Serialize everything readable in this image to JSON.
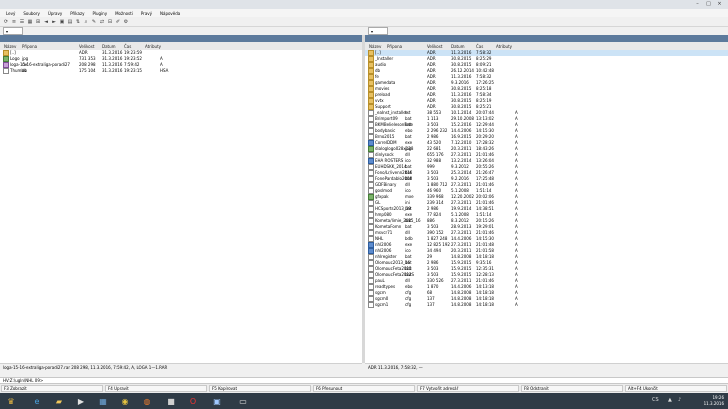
{
  "menu": [
    "Levý",
    "Soubory",
    "Úpravy",
    "Příkazy",
    "Pluginy",
    "Možnosti",
    "Pravý",
    "Nápověda"
  ],
  "left_panel": {
    "columns": {
      "name": "Název",
      "ext": "Přípona",
      "size": "Velikost",
      "date": "Datum",
      "time": "Čas",
      "attr": "Atributy"
    },
    "rows": [
      {
        "icon": "folder",
        "name": "[..]",
        "ext": "",
        "size": "ADR",
        "date": "31.3.2016",
        "time": "19:23:59",
        "attr": ""
      },
      {
        "icon": "img",
        "name": "Logo",
        "ext": "jpg",
        "size": "731 353",
        "date": "31.3.2016",
        "time": "19:23:52",
        "attr": "A"
      },
      {
        "icon": "arc",
        "name": "loga-15-16-extraliga-poradi27",
        "ext": "rar",
        "size": "208 298",
        "date": "11.3.2016",
        "time": "7:59:42",
        "attr": "A"
      },
      {
        "icon": "file",
        "name": "Thumbs",
        "ext": "db",
        "size": "175 104",
        "date": "31.3.2016",
        "time": "19:23:15",
        "attr": "HSA"
      }
    ]
  },
  "right_panel": {
    "columns": {
      "name": "Název",
      "ext": "Přípona",
      "size": "Velikost",
      "date": "Datum",
      "time": "Čas",
      "attr": "Atributy"
    },
    "rows": [
      {
        "icon": "folder",
        "name": "[..]",
        "ext": "",
        "size": "ADR",
        "date": "11.3.2016",
        "time": "7:58:32",
        "attr": ""
      },
      {
        "icon": "folder",
        "name": "_Installer",
        "ext": "",
        "size": "ADR",
        "date": "30.8.2015",
        "time": "8:25:29",
        "attr": ""
      },
      {
        "icon": "folder",
        "name": "audio",
        "ext": "",
        "size": "ADR",
        "date": "30.8.2015",
        "time": "8:09:21",
        "attr": ""
      },
      {
        "icon": "folder",
        "name": "db",
        "ext": "",
        "size": "ADR",
        "date": "26.12.2014",
        "time": "10:42:48",
        "attr": ""
      },
      {
        "icon": "folder",
        "name": "fe",
        "ext": "",
        "size": "ADR",
        "date": "11.3.2016",
        "time": "7:58:32",
        "attr": ""
      },
      {
        "icon": "folder",
        "name": "gamedata",
        "ext": "",
        "size": "ADR",
        "date": "9.3.2016",
        "time": "17:26:25",
        "attr": ""
      },
      {
        "icon": "folder",
        "name": "movies",
        "ext": "",
        "size": "ADR",
        "date": "30.8.2015",
        "time": "8:25:18",
        "attr": ""
      },
      {
        "icon": "folder",
        "name": "preload",
        "ext": "",
        "size": "ADR",
        "date": "11.3.2016",
        "time": "7:58:34",
        "attr": ""
      },
      {
        "icon": "folder",
        "name": "vvtx",
        "ext": "",
        "size": "ADR",
        "date": "30.8.2015",
        "time": "8:25:19",
        "attr": ""
      },
      {
        "icon": "folder",
        "name": "Support",
        "ext": "",
        "size": "ADR",
        "date": "30.8.2015",
        "time": "8:25:21",
        "attr": ""
      },
      {
        "icon": "file",
        "name": "_eaInst_installer",
        "ext": "txt",
        "size": "38 553",
        "date": "10.1.2014",
        "time": "20:07:44",
        "attr": "A"
      },
      {
        "icon": "file",
        "name": "Brimport09",
        "ext": "bat",
        "size": "1 113",
        "date": "29.10.2008",
        "time": "13:13:02",
        "attr": "A"
      },
      {
        "icon": "file",
        "name": "BKMBelielesonFete",
        "ext": "bat",
        "size": "3 503",
        "date": "15.2.2016",
        "time": "12:29:44",
        "attr": "A"
      },
      {
        "icon": "file",
        "name": "bodybasic",
        "ext": "ebo",
        "size": "2 296 232",
        "date": "14.4.2006",
        "time": "14:15:30",
        "attr": "A"
      },
      {
        "icon": "file",
        "name": "Brno2015",
        "ext": "bat",
        "size": "2 986",
        "date": "16.9.2015",
        "time": "20:29:20",
        "attr": "A"
      },
      {
        "icon": "exe",
        "name": "CorrelDDM",
        "ext": "exe",
        "size": "43 520",
        "date": "7.12.2010",
        "time": "17:28:32",
        "attr": "A"
      },
      {
        "icon": "img",
        "name": "dialoglogo028x128",
        "ext": "jpg",
        "size": "22 681",
        "date": "20.3.2011",
        "time": "18:43:26",
        "attr": "A"
      },
      {
        "icon": "file",
        "name": "dinlysock",
        "ext": "dll",
        "size": "655 176",
        "date": "27.3.2011",
        "time": "21:01:46",
        "attr": "A"
      },
      {
        "icon": "exe",
        "name": "EHA ROSTERS",
        "ext": "ico",
        "size": "32 988",
        "date": "13.2.2014",
        "time": "13:26:04",
        "attr": "A"
      },
      {
        "icon": "file",
        "name": "EUHDSKK_2014",
        "ext": "bat",
        "size": "999",
        "date": "9.3.2012",
        "time": "20:55:26",
        "attr": "A"
      },
      {
        "icon": "file",
        "name": "Fono/Lr/ivenn2016",
        "ext": "bat",
        "size": "3 503",
        "date": "25.3.2014",
        "time": "21:26:47",
        "attr": "A"
      },
      {
        "icon": "file",
        "name": "FonePardablo2008",
        "ext": "bat",
        "size": "3 503",
        "date": "9.2.2016",
        "time": "17:25:48",
        "attr": "A"
      },
      {
        "icon": "file",
        "name": "GDFBinary",
        "ext": "dll",
        "size": "1 880 712",
        "date": "27.3.2011",
        "time": "21:01:46",
        "attr": "A"
      },
      {
        "icon": "file",
        "name": "goslmod",
        "ext": "ico",
        "size": "46 960",
        "date": "5.1.2008",
        "time": "1:51:14",
        "attr": "A"
      },
      {
        "icon": "img",
        "name": "gfxpak",
        "ext": "mxe",
        "size": "339 968",
        "date": "12.20.2002",
        "time": "20:02:06",
        "attr": "A"
      },
      {
        "icon": "file",
        "name": "GL",
        "ext": "ini",
        "size": "239 314",
        "date": "27.3.2011",
        "time": "21:01:46",
        "attr": "A"
      },
      {
        "icon": "file",
        "name": "HCSports2013_39",
        "ext": "bat",
        "size": "2 986",
        "date": "19.9.2014",
        "time": "14:38:51",
        "attr": "A"
      },
      {
        "icon": "file",
        "name": "hmp080",
        "ext": "exe",
        "size": "77 824",
        "date": "5.1.2008",
        "time": "1:51:14",
        "attr": "A"
      },
      {
        "icon": "file",
        "name": "Kometa/limie_2015_16",
        "ext": "bat",
        "size": "886",
        "date": "8.3.2012",
        "time": "20:15:26",
        "attr": "A"
      },
      {
        "icon": "file",
        "name": "KometaFomn",
        "ext": "bat",
        "size": "3 503",
        "date": "28.9.2013",
        "time": "19:29:01",
        "attr": "A"
      },
      {
        "icon": "file",
        "name": "msvcr71",
        "ext": "dll",
        "size": "390 152",
        "date": "27.3.2011",
        "time": "21:01:46",
        "attr": "A"
      },
      {
        "icon": "file",
        "name": "NHL",
        "ext": "bdb",
        "size": "1 827 248",
        "date": "14.4.2006",
        "time": "14:15:30",
        "attr": "A"
      },
      {
        "icon": "exe",
        "name": "nhl2006",
        "ext": "exe",
        "size": "12 825 192",
        "date": "27.3.2011",
        "time": "21:01:48",
        "attr": "A"
      },
      {
        "icon": "exe",
        "name": "nhl2006",
        "ext": "ico",
        "size": "34 494",
        "date": "20.3.2011",
        "time": "21:01:58",
        "attr": "A"
      },
      {
        "icon": "file",
        "name": "nhlregister",
        "ext": "bat",
        "size": "29",
        "date": "14.8.2008",
        "time": "14:18:18",
        "attr": "A"
      },
      {
        "icon": "file",
        "name": "Olomouc2013_16",
        "ext": "bat",
        "size": "2 986",
        "date": "15.9.2015",
        "time": "9:35:16",
        "attr": "A"
      },
      {
        "icon": "file",
        "name": "OlomoucFeta2015",
        "ext": "bat",
        "size": "3 503",
        "date": "15.9.2015",
        "time": "12:35:31",
        "attr": "A"
      },
      {
        "icon": "file",
        "name": "OlomoucFeta2012S",
        "ext": "bat",
        "size": "3 503",
        "date": "15.9.2015",
        "time": "12:28:13",
        "attr": "A"
      },
      {
        "icon": "file",
        "name": "pauL",
        "ext": "dll",
        "size": "330 526",
        "date": "27.3.2011",
        "time": "21:01:46",
        "attr": "A"
      },
      {
        "icon": "file",
        "name": "readtypes",
        "ext": "ebo",
        "size": "1 870",
        "date": "14.4.2006",
        "time": "14:13:18",
        "attr": "A"
      },
      {
        "icon": "file",
        "name": "sgcm",
        "ext": "cfg",
        "size": "68",
        "date": "14.8.2008",
        "time": "14:18:18",
        "attr": "A"
      },
      {
        "icon": "file",
        "name": "sgcm0",
        "ext": "cfg",
        "size": "137",
        "date": "14.8.2008",
        "time": "14:18:18",
        "attr": "A"
      },
      {
        "icon": "file",
        "name": "sgcm1",
        "ext": "cfg",
        "size": "137",
        "date": "14.8.2008",
        "time": "14:18:18",
        "attr": "A"
      }
    ]
  },
  "status": {
    "left": "loga-15-16-extraliga-poradi27.rar  208 298, 11.3.2016, 7:59:42, A, LOGA 1—1.RAR",
    "right": "ADR  11.3.2016, 7:58:32, —"
  },
  "cmdline": "HV:Z:\\ugln\\NHL 09>",
  "fkeys": [
    "F3 Zobrazit",
    "F4 Upravit",
    "F5 Kopírovat",
    "F6 Přesunout",
    "F7 Vytvořit adresář",
    "F8 Odstranit",
    "Alt+F4 Ukončit"
  ],
  "clock": {
    "time": "19:26",
    "date": "11.3.2016"
  },
  "tray_lang": "CS"
}
